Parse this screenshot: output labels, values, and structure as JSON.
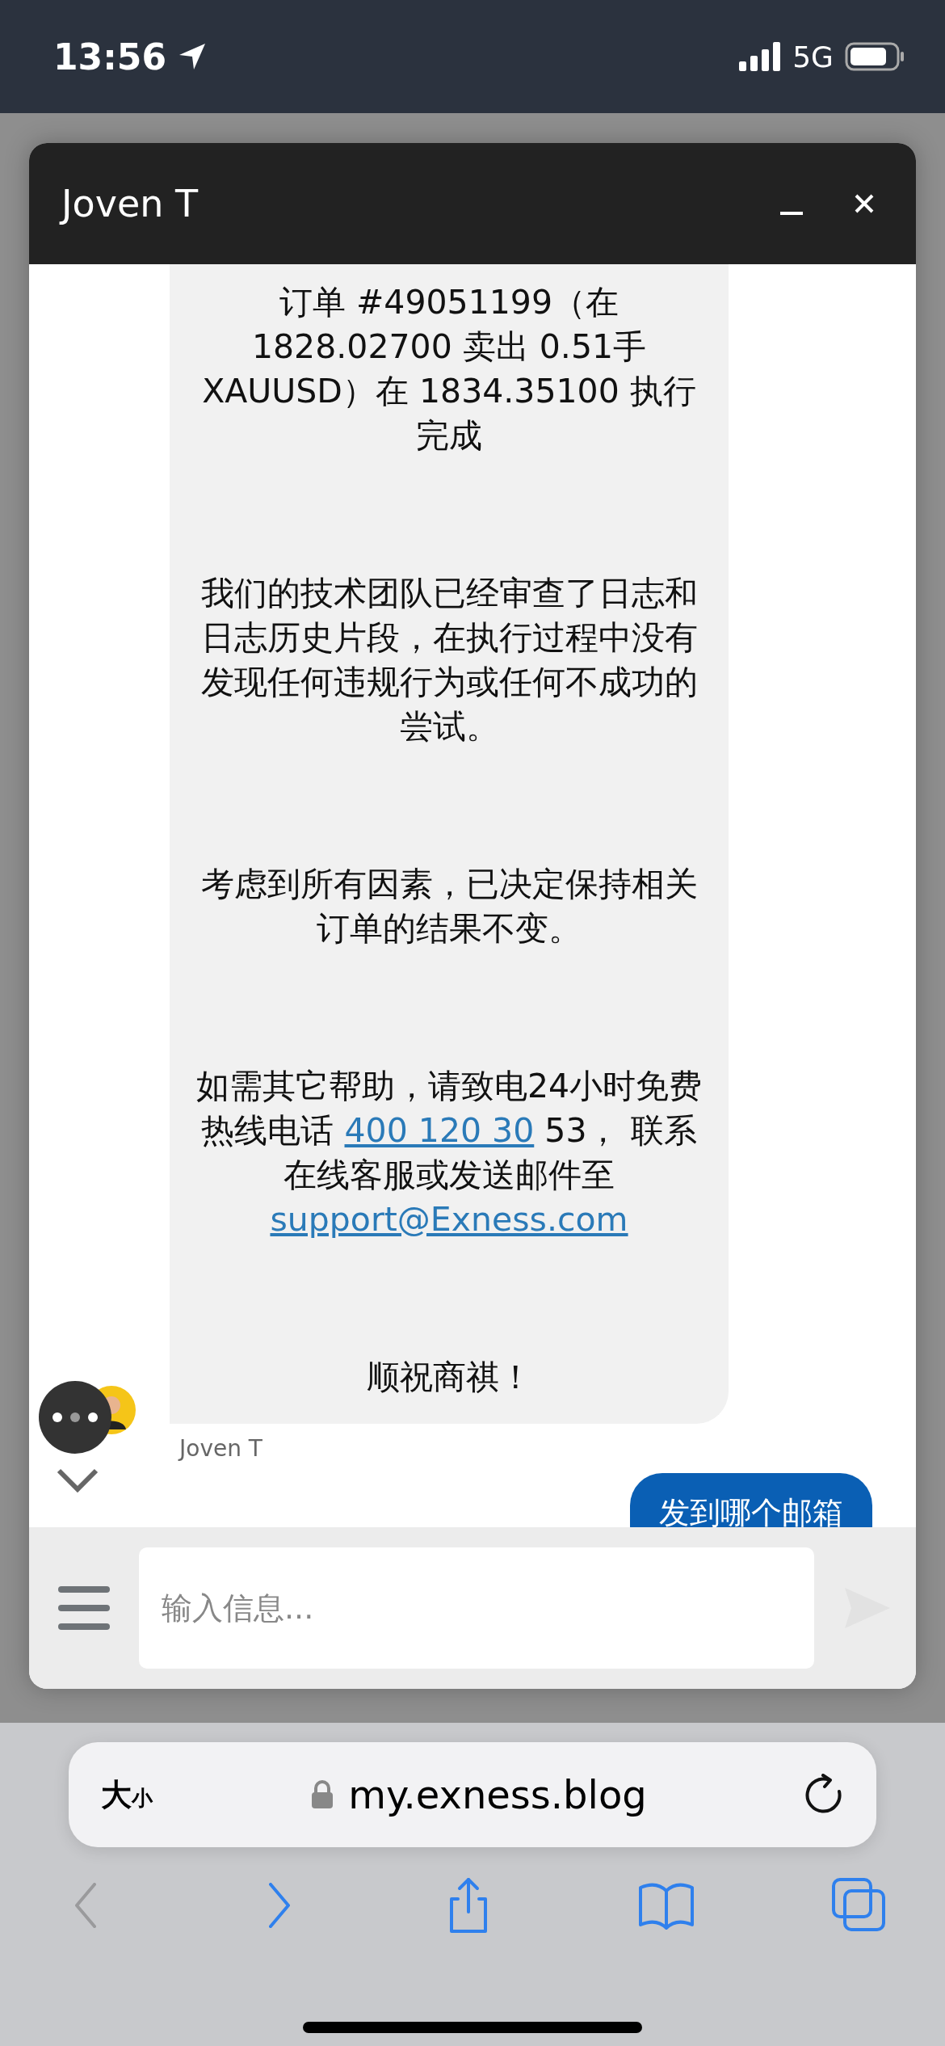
{
  "status_bar": {
    "time": "13:56",
    "network": "5G"
  },
  "chat": {
    "title": "Joven T",
    "agent_message": {
      "sender": "Joven T",
      "paragraphs": [
        [
          {
            "text": "订单 #49051199（在 1828.02700 卖出 0.51手 XAUUSD）在 1834.35100 执行完成"
          }
        ],
        [
          {
            "text": "我们的技术团队已经审查了日志和日志历史片段，在执行过程中没有发现任何违规行为或任何不成功的尝试。"
          }
        ],
        [
          {
            "text": "考虑到所有因素，已决定保持相关订单的结果不变。"
          }
        ],
        [
          {
            "text": "如需其它帮助，请致电24小时免费热线电话 "
          },
          {
            "link": "400 120 30"
          },
          {
            "text": " 53， 联系在线客服或发送邮件至 "
          },
          {
            "link": "support@Exness.com"
          }
        ],
        [
          {
            "text": "顺祝商祺！"
          }
        ]
      ]
    },
    "user_message": {
      "text": "发到哪个邮箱"
    },
    "input": {
      "placeholder": "输入信息..."
    }
  },
  "browser": {
    "text_size": {
      "large": "大",
      "small": "小"
    },
    "url": "my.exness.blog",
    "toolbar": [
      {
        "kind": "back",
        "disabled": true
      },
      {
        "kind": "forward",
        "disabled": false
      },
      {
        "kind": "share",
        "disabled": false
      },
      {
        "kind": "bookmarks",
        "disabled": false
      },
      {
        "kind": "tabs",
        "disabled": false
      }
    ]
  }
}
